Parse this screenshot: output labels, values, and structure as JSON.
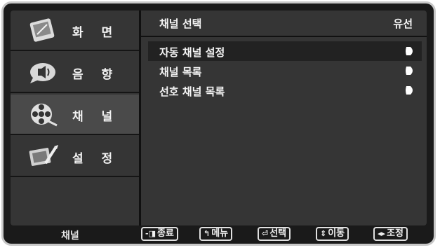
{
  "sidebar": {
    "items": [
      {
        "label": "화 면",
        "icon": "picture-icon"
      },
      {
        "label": "음 향",
        "icon": "sound-icon"
      },
      {
        "label": "채 널",
        "icon": "channel-reel-icon"
      },
      {
        "label": "설 정",
        "icon": "setup-icon"
      }
    ],
    "selected_index": 2
  },
  "panel": {
    "header": {
      "label": "채널 선택",
      "value": "유선"
    },
    "items": [
      {
        "label": "자동 채널 설정"
      },
      {
        "label": "채널 목록"
      },
      {
        "label": "선호 채널 목록"
      }
    ],
    "selected_index": 0
  },
  "footer": {
    "label": "채널",
    "buttons": [
      {
        "icon": "exit-icon",
        "glyph": "-◨",
        "label": "종료"
      },
      {
        "icon": "return-icon",
        "glyph": "↰",
        "label": "메뉴"
      },
      {
        "icon": "enter-icon",
        "glyph": "⏎",
        "label": "선택"
      },
      {
        "icon": "updown-icon",
        "glyph": "⇕",
        "label": "이동"
      },
      {
        "icon": "leftright-icon",
        "glyph": "◂▸",
        "label": "조정"
      }
    ]
  },
  "colors": {
    "background": "#353535",
    "selected": "#4a4a4a",
    "text": "#f5f5f5"
  }
}
